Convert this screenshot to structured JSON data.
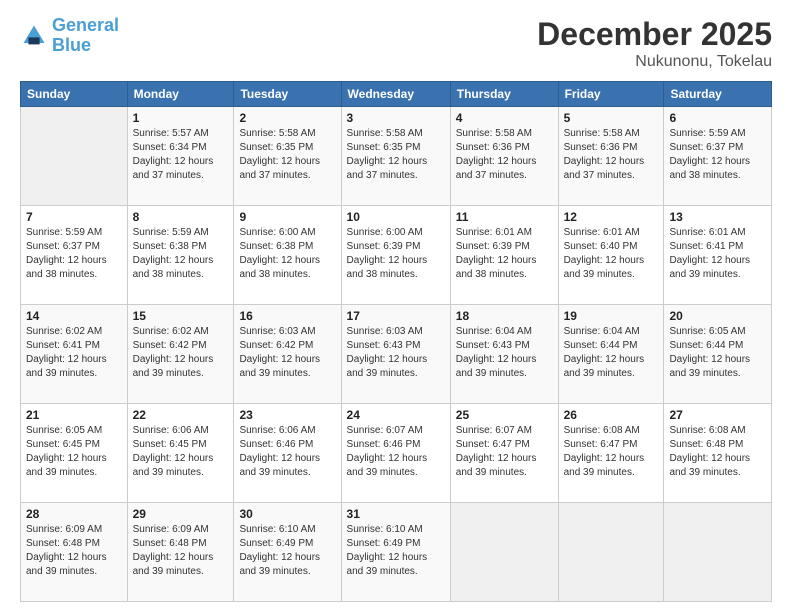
{
  "logo": {
    "line1": "General",
    "line2": "Blue"
  },
  "title": "December 2025",
  "subtitle": "Nukunonu, Tokelau",
  "days_of_week": [
    "Sunday",
    "Monday",
    "Tuesday",
    "Wednesday",
    "Thursday",
    "Friday",
    "Saturday"
  ],
  "weeks": [
    [
      {
        "day": "",
        "sunrise": "",
        "sunset": "",
        "daylight": ""
      },
      {
        "day": "1",
        "sunrise": "Sunrise: 5:57 AM",
        "sunset": "Sunset: 6:34 PM",
        "daylight": "Daylight: 12 hours and 37 minutes."
      },
      {
        "day": "2",
        "sunrise": "Sunrise: 5:58 AM",
        "sunset": "Sunset: 6:35 PM",
        "daylight": "Daylight: 12 hours and 37 minutes."
      },
      {
        "day": "3",
        "sunrise": "Sunrise: 5:58 AM",
        "sunset": "Sunset: 6:35 PM",
        "daylight": "Daylight: 12 hours and 37 minutes."
      },
      {
        "day": "4",
        "sunrise": "Sunrise: 5:58 AM",
        "sunset": "Sunset: 6:36 PM",
        "daylight": "Daylight: 12 hours and 37 minutes."
      },
      {
        "day": "5",
        "sunrise": "Sunrise: 5:58 AM",
        "sunset": "Sunset: 6:36 PM",
        "daylight": "Daylight: 12 hours and 37 minutes."
      },
      {
        "day": "6",
        "sunrise": "Sunrise: 5:59 AM",
        "sunset": "Sunset: 6:37 PM",
        "daylight": "Daylight: 12 hours and 38 minutes."
      }
    ],
    [
      {
        "day": "7",
        "sunrise": "Sunrise: 5:59 AM",
        "sunset": "Sunset: 6:37 PM",
        "daylight": "Daylight: 12 hours and 38 minutes."
      },
      {
        "day": "8",
        "sunrise": "Sunrise: 5:59 AM",
        "sunset": "Sunset: 6:38 PM",
        "daylight": "Daylight: 12 hours and 38 minutes."
      },
      {
        "day": "9",
        "sunrise": "Sunrise: 6:00 AM",
        "sunset": "Sunset: 6:38 PM",
        "daylight": "Daylight: 12 hours and 38 minutes."
      },
      {
        "day": "10",
        "sunrise": "Sunrise: 6:00 AM",
        "sunset": "Sunset: 6:39 PM",
        "daylight": "Daylight: 12 hours and 38 minutes."
      },
      {
        "day": "11",
        "sunrise": "Sunrise: 6:01 AM",
        "sunset": "Sunset: 6:39 PM",
        "daylight": "Daylight: 12 hours and 38 minutes."
      },
      {
        "day": "12",
        "sunrise": "Sunrise: 6:01 AM",
        "sunset": "Sunset: 6:40 PM",
        "daylight": "Daylight: 12 hours and 39 minutes."
      },
      {
        "day": "13",
        "sunrise": "Sunrise: 6:01 AM",
        "sunset": "Sunset: 6:41 PM",
        "daylight": "Daylight: 12 hours and 39 minutes."
      }
    ],
    [
      {
        "day": "14",
        "sunrise": "Sunrise: 6:02 AM",
        "sunset": "Sunset: 6:41 PM",
        "daylight": "Daylight: 12 hours and 39 minutes."
      },
      {
        "day": "15",
        "sunrise": "Sunrise: 6:02 AM",
        "sunset": "Sunset: 6:42 PM",
        "daylight": "Daylight: 12 hours and 39 minutes."
      },
      {
        "day": "16",
        "sunrise": "Sunrise: 6:03 AM",
        "sunset": "Sunset: 6:42 PM",
        "daylight": "Daylight: 12 hours and 39 minutes."
      },
      {
        "day": "17",
        "sunrise": "Sunrise: 6:03 AM",
        "sunset": "Sunset: 6:43 PM",
        "daylight": "Daylight: 12 hours and 39 minutes."
      },
      {
        "day": "18",
        "sunrise": "Sunrise: 6:04 AM",
        "sunset": "Sunset: 6:43 PM",
        "daylight": "Daylight: 12 hours and 39 minutes."
      },
      {
        "day": "19",
        "sunrise": "Sunrise: 6:04 AM",
        "sunset": "Sunset: 6:44 PM",
        "daylight": "Daylight: 12 hours and 39 minutes."
      },
      {
        "day": "20",
        "sunrise": "Sunrise: 6:05 AM",
        "sunset": "Sunset: 6:44 PM",
        "daylight": "Daylight: 12 hours and 39 minutes."
      }
    ],
    [
      {
        "day": "21",
        "sunrise": "Sunrise: 6:05 AM",
        "sunset": "Sunset: 6:45 PM",
        "daylight": "Daylight: 12 hours and 39 minutes."
      },
      {
        "day": "22",
        "sunrise": "Sunrise: 6:06 AM",
        "sunset": "Sunset: 6:45 PM",
        "daylight": "Daylight: 12 hours and 39 minutes."
      },
      {
        "day": "23",
        "sunrise": "Sunrise: 6:06 AM",
        "sunset": "Sunset: 6:46 PM",
        "daylight": "Daylight: 12 hours and 39 minutes."
      },
      {
        "day": "24",
        "sunrise": "Sunrise: 6:07 AM",
        "sunset": "Sunset: 6:46 PM",
        "daylight": "Daylight: 12 hours and 39 minutes."
      },
      {
        "day": "25",
        "sunrise": "Sunrise: 6:07 AM",
        "sunset": "Sunset: 6:47 PM",
        "daylight": "Daylight: 12 hours and 39 minutes."
      },
      {
        "day": "26",
        "sunrise": "Sunrise: 6:08 AM",
        "sunset": "Sunset: 6:47 PM",
        "daylight": "Daylight: 12 hours and 39 minutes."
      },
      {
        "day": "27",
        "sunrise": "Sunrise: 6:08 AM",
        "sunset": "Sunset: 6:48 PM",
        "daylight": "Daylight: 12 hours and 39 minutes."
      }
    ],
    [
      {
        "day": "28",
        "sunrise": "Sunrise: 6:09 AM",
        "sunset": "Sunset: 6:48 PM",
        "daylight": "Daylight: 12 hours and 39 minutes."
      },
      {
        "day": "29",
        "sunrise": "Sunrise: 6:09 AM",
        "sunset": "Sunset: 6:48 PM",
        "daylight": "Daylight: 12 hours and 39 minutes."
      },
      {
        "day": "30",
        "sunrise": "Sunrise: 6:10 AM",
        "sunset": "Sunset: 6:49 PM",
        "daylight": "Daylight: 12 hours and 39 minutes."
      },
      {
        "day": "31",
        "sunrise": "Sunrise: 6:10 AM",
        "sunset": "Sunset: 6:49 PM",
        "daylight": "Daylight: 12 hours and 39 minutes."
      },
      {
        "day": "",
        "sunrise": "",
        "sunset": "",
        "daylight": ""
      },
      {
        "day": "",
        "sunrise": "",
        "sunset": "",
        "daylight": ""
      },
      {
        "day": "",
        "sunrise": "",
        "sunset": "",
        "daylight": ""
      }
    ]
  ]
}
